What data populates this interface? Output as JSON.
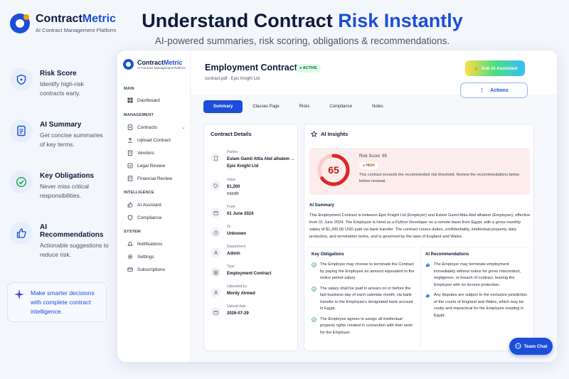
{
  "brand": {
    "name_part1": "Contract",
    "name_part2": "Metric",
    "tagline": "AI Contract Management Platform"
  },
  "hero": {
    "title_part1": "Understand Contract ",
    "title_highlight": "Risk Instantly",
    "subtitle": "AI-powered summaries, risk scoring, obligations & recommendations."
  },
  "features": [
    {
      "title": "Risk Score",
      "desc": "Identify high-risk contracts early.",
      "icon": "shield-icon"
    },
    {
      "title": "AI Summary",
      "desc": "Get concise summaries of key terms.",
      "icon": "document-icon"
    },
    {
      "title": "Key Obligations",
      "desc": "Never miss critical responsibilities.",
      "icon": "check-circle-icon"
    },
    {
      "title": "AI Recommendations",
      "desc": "Actionable suggestions to reduce risk.",
      "icon": "thumbs-up-icon"
    }
  ],
  "promo": {
    "text": "Make smarter decisions with complete contract intelligence.",
    "icon": "sparkle-icon"
  },
  "sidebar": {
    "brand_part1": "Contract",
    "brand_part2": "Metric",
    "tagline": "AI Contract Management Platform",
    "sections": {
      "main": "MAIN",
      "management": "MANAGEMENT",
      "intelligence": "INTELLIGENCE",
      "system": "SYSTEM"
    },
    "items": {
      "dashboard": "Dashboard",
      "contracts": "Contracts",
      "upload": "Upload Contract",
      "vendors": "Vendors",
      "legal": "Legal Review",
      "financial": "Financial Review",
      "ai_assistant": "AI Assistant",
      "compliance": "Compliance",
      "notifications": "Notifications",
      "settings": "Settings",
      "subscriptions": "Subscriptions"
    }
  },
  "header": {
    "title": "Employment Contract",
    "status": "● ACTIVE",
    "file": "contract.pdf · Epic Knight Ltd",
    "ask_ai": "Ask AI Assistant",
    "actions": "Actions"
  },
  "tabs": [
    "Summary",
    "Clauses Page",
    "Risks",
    "Compliance",
    "Notes"
  ],
  "details": {
    "heading": "Contract Details",
    "rows": {
      "parties": {
        "label": "Parties",
        "value": "Eslam Gamil Attia Abd alhalem ↔",
        "sub": "Epic Knight Ltd"
      },
      "value": {
        "label": "Value",
        "value": "$1,200",
        "sub": "month"
      },
      "from": {
        "label": "From",
        "value": "01 June 2024"
      },
      "to": {
        "label": "To",
        "value": "Unknown"
      },
      "department": {
        "label": "Department",
        "value": "Admin"
      },
      "type": {
        "label": "Type",
        "value": "Employment Contract"
      },
      "uploaded_by": {
        "label": "Uploaded by",
        "value": "Mordy Ahmed"
      },
      "upload_date": {
        "label": "Upload date",
        "value": "2026-07-29"
      }
    }
  },
  "insights": {
    "heading": "AI Insights",
    "risk": {
      "score_number": "65",
      "score_fraction": 0.65,
      "score_label": "Risk Score: 65",
      "level": "● HIGH",
      "message": "This contract exceeds the recommended risk threshold. Review the recommendations below before renewal."
    },
    "summary_heading": "AI Summary",
    "summary_text": "This Employment Contract is between Epic Knight Ltd (Employer) and Eslam Gamil Attia Abd alhalem (Employee), effective from 01 June 2024. The Employee is hired as a Python Developer on a remote basis from Egypt, with a gross monthly salary of $1,200.00 USD paid via bank transfer. The contract covers duties, confidentiality, intellectual property, data protection, and termination terms, and is governed by the laws of England and Wales.",
    "obligations_heading": "Key Obligations",
    "obligations": [
      "The Employer may choose to terminate the Contract by paying the Employee an amount equivalent to the notice period salary.",
      "The salary shall be paid in arrears on or before the last business day of each calendar month, via bank transfer to the Employee's designated bank account in Egypt.",
      "The Employee agrees to assign all intellectual property rights created in connection with their work for the Employer."
    ],
    "recommendations_heading": "AI Recommendations",
    "recommendations": [
      "The Employer may terminate employment immediately without notice for gross misconduct, negligence, or breach of contract, leaving the Employee with no income protection.",
      "Any disputes are subject to the exclusive jurisdiction of the courts of England and Wales, which may be costly and impractical for the Employee residing in Egypt."
    ]
  },
  "chat": {
    "label": "Team Chat"
  },
  "colors": {
    "primary": "#1d4ed8",
    "risk": "#dc2626",
    "active": "#16a34a"
  }
}
